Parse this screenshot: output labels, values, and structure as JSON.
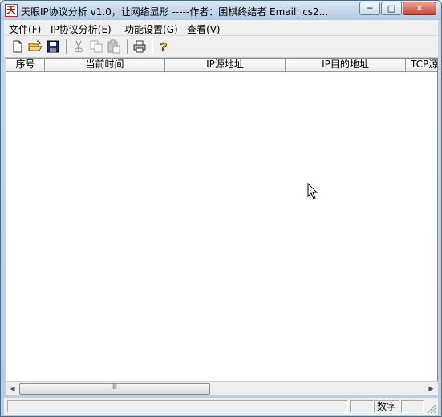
{
  "window": {
    "title": "天眼IP协议分析 v1.0，让网络显形 -----作者：围棋终结者  Email: cs2...",
    "app_icon_glyph": "天",
    "minimize_glyph": "─",
    "maximize_glyph": "□",
    "close_glyph": "✕"
  },
  "menu": {
    "items": [
      {
        "label": "文件",
        "key": "(F)"
      },
      {
        "label": "IP协议分析",
        "key": "(E)"
      },
      {
        "label": "功能设置",
        "key": "(G)"
      },
      {
        "label": "查看",
        "key": "(V)"
      }
    ]
  },
  "toolbar": {
    "buttons": [
      "new-file-icon",
      "open-folder-icon",
      "save-icon",
      "cut-icon",
      "copy-icon",
      "paste-icon",
      "print-icon",
      "help-icon"
    ]
  },
  "list": {
    "columns": [
      "序号",
      "当前时间",
      "IP源地址",
      "IP目的地址",
      "TCP源"
    ]
  },
  "scrollbar": {
    "grip": "Ⅲ",
    "left_arrow": "◀",
    "right_arrow": "▶"
  },
  "status": {
    "num_indicator": "数字"
  },
  "colors": {
    "titlebar": "#c6d7ea",
    "close_button": "#c6463a"
  }
}
